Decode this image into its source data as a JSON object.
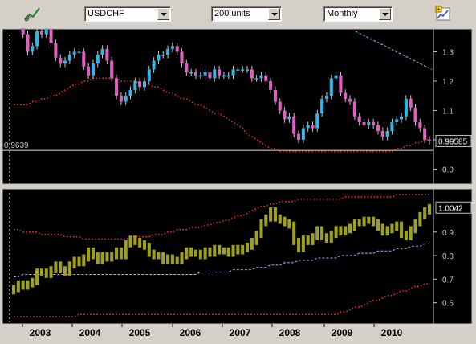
{
  "toolbar": {
    "symbol": "USDCHF",
    "units": "200 units",
    "period": "Monthly",
    "icons": [
      "draw-tool-icon",
      "chart-settings-icon"
    ]
  },
  "colors": {
    "background": "#000000",
    "up_candle": "#33b5e5",
    "down_candle": "#e060c0",
    "ma_dotted": "#ff3030",
    "trend_dashed": "#aab4ff",
    "hlc_bars": "#a0a020",
    "axis_text": "#c8c8c8"
  },
  "chart_data": [
    {
      "type": "candlestick",
      "panel": "price",
      "symbol": "USDCHF",
      "ylim": [
        0.86,
        1.37
      ],
      "ytick_labels": [
        "1.3",
        "1.2",
        "1.1",
        "1",
        "0.9"
      ],
      "y_values": [
        1.3,
        1.2,
        1.1,
        1.0,
        0.9
      ],
      "current_value_label": "0.99585",
      "crosshair_value_label": "0.9639",
      "crosshair_value": 0.9639,
      "series_close": [
        1.39,
        1.4,
        1.36,
        1.3,
        1.32,
        1.37,
        1.36,
        1.38,
        1.33,
        1.28,
        1.26,
        1.27,
        1.29,
        1.3,
        1.3,
        1.25,
        1.22,
        1.26,
        1.29,
        1.31,
        1.27,
        1.21,
        1.15,
        1.13,
        1.15,
        1.17,
        1.2,
        1.18,
        1.2,
        1.24,
        1.27,
        1.29,
        1.29,
        1.31,
        1.32,
        1.3,
        1.26,
        1.23,
        1.23,
        1.22,
        1.22,
        1.23,
        1.21,
        1.24,
        1.22,
        1.22,
        1.22,
        1.24,
        1.24,
        1.24,
        1.24,
        1.21,
        1.21,
        1.22,
        1.2,
        1.17,
        1.13,
        1.1,
        1.07,
        1.08,
        1.02,
        1.0,
        1.04,
        1.05,
        1.04,
        1.09,
        1.14,
        1.15,
        1.21,
        1.22,
        1.16,
        1.14,
        1.13,
        1.08,
        1.06,
        1.05,
        1.06,
        1.05,
        1.03,
        1.01,
        1.03,
        1.06,
        1.07,
        1.08,
        1.14,
        1.11,
        1.06,
        1.04,
        1.0,
        0.99585
      ],
      "ma_line": [
        1.12,
        1.12,
        1.12,
        1.12,
        1.13,
        1.13,
        1.14,
        1.14,
        1.15,
        1.15,
        1.16,
        1.17,
        1.18,
        1.19,
        1.19,
        1.2,
        1.2,
        1.21,
        1.21,
        1.21,
        1.21,
        1.21,
        1.21,
        1.2,
        1.2,
        1.2,
        1.2,
        1.19,
        1.19,
        1.19,
        1.18,
        1.18,
        1.17,
        1.16,
        1.16,
        1.15,
        1.14,
        1.14,
        1.13,
        1.12,
        1.12,
        1.11,
        1.1,
        1.09,
        1.09,
        1.08,
        1.07,
        1.06,
        1.05,
        1.04,
        1.02,
        1.01,
        1.0,
        0.99,
        0.98,
        0.97,
        0.97,
        0.96,
        0.96,
        0.96,
        0.96,
        0.96,
        0.96,
        0.96,
        0.96,
        0.96,
        0.96,
        0.96,
        0.96,
        0.96,
        0.96,
        0.96,
        0.96,
        0.96,
        0.96,
        0.96,
        0.96,
        0.96,
        0.96,
        0.96,
        0.96,
        0.96,
        0.97,
        0.97,
        0.98,
        0.98,
        0.99,
        0.99,
        1.0,
        1.0
      ],
      "trend_line": [
        [
          118,
          1.37
        ],
        [
          160,
          1.24
        ]
      ]
    },
    {
      "type": "hlc-bars",
      "panel": "oscillator",
      "ylim": [
        0.52,
        1.07
      ],
      "ytick_labels": [
        "0.9",
        "0.8",
        "0.7",
        "0.6"
      ],
      "y_values": [
        0.9,
        0.8,
        0.7,
        0.6
      ],
      "current_value_label": "1.0042",
      "series": [
        0.66,
        0.68,
        0.67,
        0.68,
        0.69,
        0.73,
        0.73,
        0.72,
        0.74,
        0.76,
        0.74,
        0.73,
        0.76,
        0.78,
        0.77,
        0.79,
        0.82,
        0.8,
        0.78,
        0.8,
        0.79,
        0.8,
        0.82,
        0.8,
        0.85,
        0.87,
        0.86,
        0.85,
        0.84,
        0.81,
        0.8,
        0.8,
        0.78,
        0.79,
        0.78,
        0.78,
        0.8,
        0.82,
        0.81,
        0.81,
        0.8,
        0.82,
        0.81,
        0.83,
        0.82,
        0.82,
        0.81,
        0.83,
        0.82,
        0.83,
        0.84,
        0.86,
        0.89,
        0.94,
        0.96,
        0.99,
        0.96,
        0.95,
        0.94,
        0.93,
        0.86,
        0.83,
        0.87,
        0.86,
        0.88,
        0.91,
        0.88,
        0.87,
        0.89,
        0.91,
        0.9,
        0.91,
        0.92,
        0.94,
        0.94,
        0.95,
        0.95,
        0.94,
        0.92,
        0.9,
        0.91,
        0.92,
        0.93,
        0.89,
        0.88,
        0.91,
        0.94,
        0.97,
        0.99,
        1.0042
      ],
      "upper_band": [
        0.91,
        0.91,
        0.9,
        0.9,
        0.9,
        0.9,
        0.89,
        0.89,
        0.89,
        0.89,
        0.89,
        0.88,
        0.88,
        0.88,
        0.88,
        0.87,
        0.87,
        0.87,
        0.87,
        0.87,
        0.87,
        0.87,
        0.87,
        0.87,
        0.87,
        0.88,
        0.88,
        0.88,
        0.88,
        0.88,
        0.89,
        0.89,
        0.89,
        0.9,
        0.9,
        0.91,
        0.91,
        0.91,
        0.92,
        0.92,
        0.92,
        0.93,
        0.93,
        0.94,
        0.94,
        0.95,
        0.95,
        0.96,
        0.97,
        0.97,
        0.98,
        0.99,
        1.0,
        1.01,
        1.01,
        1.02,
        1.02,
        1.03,
        1.03,
        1.03,
        1.03,
        1.04,
        1.04,
        1.04,
        1.04,
        1.04,
        1.04,
        1.04,
        1.04,
        1.04,
        1.04,
        1.05,
        1.05,
        1.05,
        1.05,
        1.05,
        1.05,
        1.05,
        1.05,
        1.05,
        1.05,
        1.05,
        1.06,
        1.06,
        1.06,
        1.06,
        1.06,
        1.06,
        1.06,
        1.06
      ],
      "lower_band": [
        0.54,
        0.54,
        0.54,
        0.54,
        0.54,
        0.54,
        0.54,
        0.54,
        0.54,
        0.54,
        0.54,
        0.54,
        0.54,
        0.54,
        0.55,
        0.55,
        0.55,
        0.55,
        0.55,
        0.55,
        0.55,
        0.55,
        0.55,
        0.55,
        0.55,
        0.55,
        0.55,
        0.55,
        0.55,
        0.55,
        0.55,
        0.55,
        0.55,
        0.55,
        0.55,
        0.55,
        0.55,
        0.55,
        0.55,
        0.55,
        0.55,
        0.55,
        0.55,
        0.55,
        0.55,
        0.55,
        0.55,
        0.55,
        0.55,
        0.55,
        0.55,
        0.55,
        0.55,
        0.55,
        0.55,
        0.55,
        0.55,
        0.55,
        0.55,
        0.55,
        0.55,
        0.55,
        0.55,
        0.55,
        0.55,
        0.55,
        0.55,
        0.55,
        0.55,
        0.55,
        0.56,
        0.56,
        0.57,
        0.58,
        0.58,
        0.59,
        0.6,
        0.61,
        0.61,
        0.62,
        0.63,
        0.63,
        0.64,
        0.65,
        0.65,
        0.66,
        0.67,
        0.67,
        0.68,
        0.68
      ],
      "trend_line": [
        0.71,
        0.71,
        0.72,
        0.72,
        0.72,
        0.72,
        0.72,
        0.72,
        0.72,
        0.72,
        0.72,
        0.72,
        0.72,
        0.72,
        0.72,
        0.72,
        0.72,
        0.72,
        0.72,
        0.72,
        0.72,
        0.72,
        0.72,
        0.72,
        0.72,
        0.72,
        0.72,
        0.72,
        0.72,
        0.72,
        0.72,
        0.72,
        0.72,
        0.72,
        0.72,
        0.72,
        0.72,
        0.72,
        0.72,
        0.72,
        0.73,
        0.73,
        0.73,
        0.73,
        0.73,
        0.73,
        0.73,
        0.74,
        0.74,
        0.74,
        0.74,
        0.74,
        0.75,
        0.75,
        0.75,
        0.76,
        0.76,
        0.76,
        0.77,
        0.77,
        0.77,
        0.78,
        0.78,
        0.78,
        0.78,
        0.79,
        0.79,
        0.79,
        0.79,
        0.79,
        0.8,
        0.8,
        0.8,
        0.8,
        0.81,
        0.81,
        0.81,
        0.81,
        0.82,
        0.82,
        0.82,
        0.82,
        0.83,
        0.83,
        0.83,
        0.84,
        0.84,
        0.84,
        0.85,
        0.85
      ]
    }
  ],
  "xaxis": {
    "labels": [
      "2003",
      "2004",
      "2005",
      "2006",
      "2007",
      "2008",
      "2009",
      "2010"
    ]
  }
}
